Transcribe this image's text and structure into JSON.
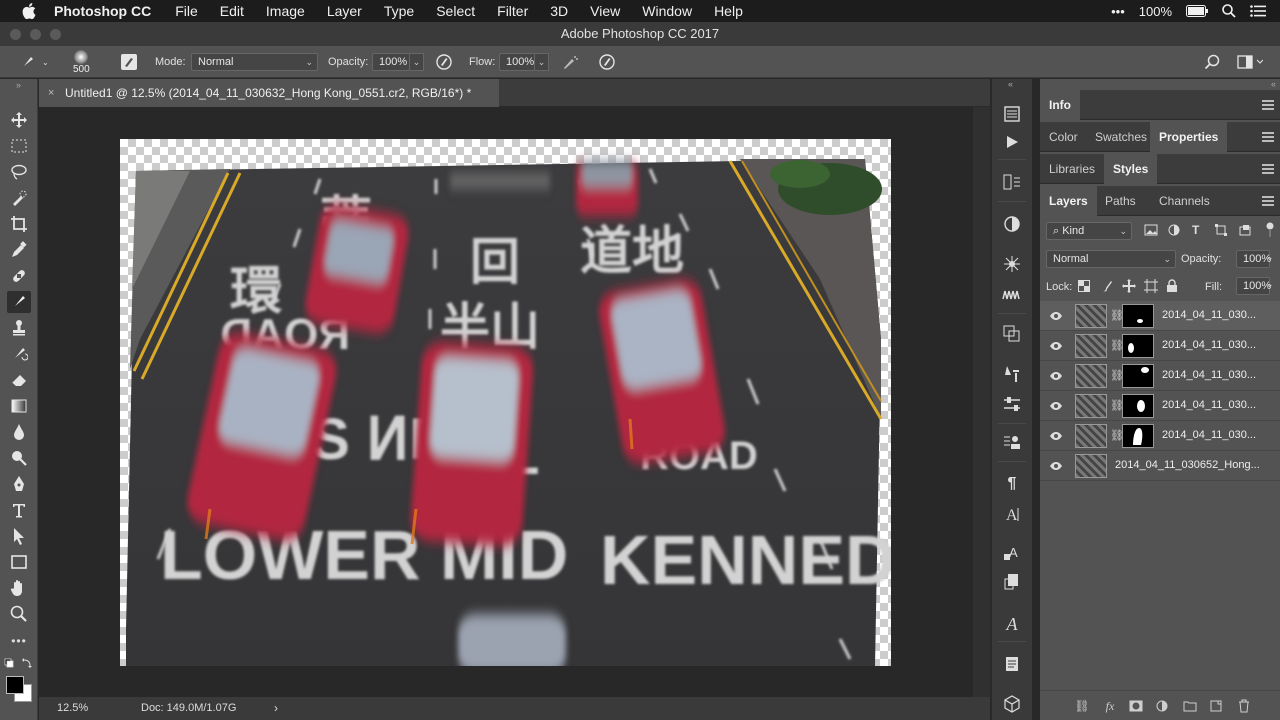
{
  "menubar": {
    "apple_icon": "apple-logo-icon",
    "items": [
      "Photoshop CC",
      "File",
      "Edit",
      "Image",
      "Layer",
      "Type",
      "Select",
      "Filter",
      "3D",
      "View",
      "Window",
      "Help"
    ],
    "battery": "100%"
  },
  "window": {
    "title": "Adobe Photoshop CC 2017"
  },
  "options": {
    "brush_size": "500",
    "mode_label": "Mode:",
    "mode_value": "Normal",
    "opacity_label": "Opacity:",
    "opacity_value": "100%",
    "flow_label": "Flow:",
    "flow_value": "100%"
  },
  "document": {
    "tab_title": "Untitled1 @ 12.5% (2014_04_11_030632_Hong Kong_0551.cr2, RGB/16*) *",
    "close_glyph": "×"
  },
  "status": {
    "zoom": "12.5%",
    "doc": "Doc: 149.0M/1.07G"
  },
  "panels": {
    "info_tab": "Info",
    "color_tab": "Color",
    "swatches_tab": "Swatches",
    "properties_tab": "Properties",
    "libraries_tab": "Libraries",
    "styles_tab": "Styles",
    "layers_tab": "Layers",
    "paths_tab": "Paths",
    "channels_tab": "Channels"
  },
  "layers": {
    "filter_kind": "Kind",
    "blend_mode": "Normal",
    "opacity_label": "Opacity:",
    "opacity_value": "100%",
    "lock_label": "Lock:",
    "fill_label": "Fill:",
    "fill_value": "100%",
    "items": [
      {
        "name": "2014_04_11_030...",
        "has_mask": true
      },
      {
        "name": "2014_04_11_030...",
        "has_mask": true
      },
      {
        "name": "2014_04_11_030...",
        "has_mask": true
      },
      {
        "name": "2014_04_11_030...",
        "has_mask": true
      },
      {
        "name": "2014_04_11_030...",
        "has_mask": true
      },
      {
        "name": "2014_04_11_030652_Hong...",
        "has_mask": false
      }
    ]
  },
  "colors": {
    "accent": "#535353",
    "road": "#3a3a3a",
    "taxi_red": "#b2283f",
    "lane_yellow": "#d9a928"
  }
}
